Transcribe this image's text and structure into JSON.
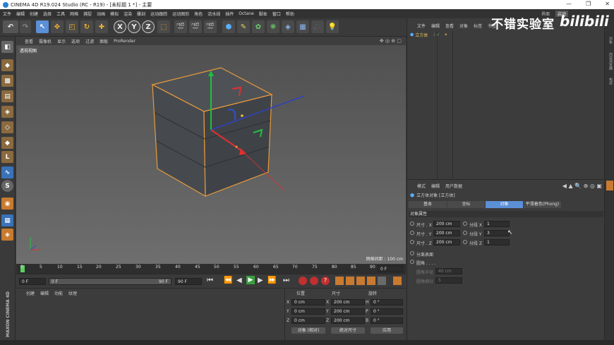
{
  "window": {
    "title": "CINEMA 4D R19.024 Studio (RC - R19) - [未标题 1 *] - 主要"
  },
  "menu": [
    "文件",
    "编辑",
    "创建",
    "选择",
    "工具",
    "网格",
    "捕捉",
    "动画",
    "模拟",
    "渲染",
    "雕刻",
    "运动跟踪",
    "运动图形",
    "角色",
    "流水线",
    "插件",
    "Octane",
    "脚本",
    "窗口",
    "帮助"
  ],
  "layout_label": "界面",
  "layout_value": "启动",
  "viewport": {
    "menu": [
      "查看",
      "摄像机",
      "显示",
      "选项",
      "过滤",
      "面板",
      "ProRender"
    ],
    "camera_label": "透视视图",
    "grid_label": "网格间距 : 100 cm"
  },
  "timeline": {
    "ticks": [
      "0",
      "5",
      "10",
      "15",
      "20",
      "25",
      "30",
      "35",
      "40",
      "45",
      "50",
      "55",
      "60",
      "65",
      "70",
      "75",
      "80",
      "85",
      "90"
    ],
    "end_frame": "0 F",
    "start_field": "0 F",
    "current_field": "0 F",
    "range_end": "90 F",
    "end_field": "90 F"
  },
  "material": {
    "menu": [
      "创建",
      "编辑",
      "功能",
      "纹理"
    ]
  },
  "coordinates": {
    "headers": [
      "位置",
      "尺寸",
      "旋转"
    ],
    "rows": [
      {
        "axis": "X",
        "pos": "0 cm",
        "size": "200 cm",
        "rot_label": "H",
        "rot": "0 °"
      },
      {
        "axis": "Y",
        "pos": "0 cm",
        "size": "200 cm",
        "rot_label": "P",
        "rot": "0 °"
      },
      {
        "axis": "Z",
        "pos": "0 cm",
        "size": "200 cm",
        "rot_label": "B",
        "rot": "0 °"
      }
    ],
    "mode": "对象 (相对)",
    "size_mode": "绝对尺寸",
    "apply": "应用"
  },
  "object_manager": {
    "menu": [
      "文件",
      "编辑",
      "查看",
      "对象",
      "标签",
      "书签"
    ],
    "object_name": "立方体"
  },
  "attributes": {
    "menu": [
      "模式",
      "编辑",
      "用户数据"
    ],
    "title": "立方体对象 [立方体]",
    "tabs": [
      "基本",
      "坐标",
      "对象",
      "平滑着色(Phong)"
    ],
    "section": "对象属性",
    "size_x_label": "尺寸 . X",
    "size_x": "200 cm",
    "size_y_label": "尺寸 . Y",
    "size_y": "200 cm",
    "size_z_label": "尺寸 . Z",
    "size_z": "200 cm",
    "seg_x_label": "分段 X",
    "seg_x": "1",
    "seg_y_label": "分段 Y",
    "seg_y": "3",
    "seg_z_label": "分段 Z",
    "seg_z": "1",
    "separate_label": "分离表面",
    "separate_val": "",
    "fillet_label": "圆角 . . . .",
    "fillet_val": "",
    "fillet_radius_label": "圆角半径",
    "fillet_radius": "40 cm",
    "fillet_sub_label": "圆角细分",
    "fillet_sub": "5"
  },
  "right_tabs": [
    "对象",
    "内容浏览器",
    "构造"
  ],
  "watermark": "不错实验室",
  "brand": "bilibili",
  "maxon": "MAXON CINEMA 4D",
  "colors": {
    "accent": "#5b8fd6",
    "selection": "#e89a3a",
    "bg": "#3a3a3a"
  }
}
